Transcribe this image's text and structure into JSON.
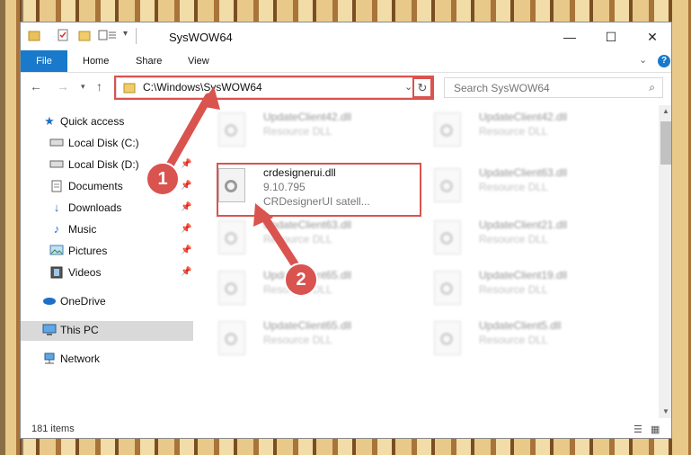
{
  "window": {
    "title": "SysWOW64",
    "controls": {
      "minimize": "—",
      "maximize": "☐",
      "close": "✕"
    }
  },
  "ribbon": {
    "file_label": "File",
    "tabs": [
      "Home",
      "Share",
      "View"
    ],
    "help_label": "?"
  },
  "navigation": {
    "address": "C:\\Windows\\SysWOW64",
    "search_placeholder": "Search SysWOW64"
  },
  "sidebar": {
    "items": [
      {
        "label": "Quick access",
        "icon": "star-icon"
      },
      {
        "label": "Local Disk (C:)",
        "icon": "drive-icon"
      },
      {
        "label": "Local Disk (D:)",
        "icon": "drive-icon"
      },
      {
        "label": "Documents",
        "icon": "documents-icon"
      },
      {
        "label": "Downloads",
        "icon": "download-icon"
      },
      {
        "label": "Music",
        "icon": "music-icon"
      },
      {
        "label": "Pictures",
        "icon": "pictures-icon"
      },
      {
        "label": "Videos",
        "icon": "videos-icon"
      },
      {
        "label": "OneDrive",
        "icon": "cloud-icon"
      },
      {
        "label": "This PC",
        "icon": "computer-icon"
      },
      {
        "label": "Network",
        "icon": "network-icon"
      }
    ]
  },
  "files": {
    "selected": {
      "name": "crdesignerui.dll",
      "version": "9.10.795",
      "description": "CRDesignerUI satell..."
    },
    "left_column": [
      {
        "name": "UpdateClient42.dll",
        "description": "Resource DLL"
      },
      {
        "name": "UpdateClient63.dll",
        "description": "Resource DLL"
      },
      {
        "name": "UpdateClient65.dll",
        "description": "Resource DLL"
      },
      {
        "name": "UpdateClient65.dll",
        "description": "Resource DLL"
      }
    ],
    "right_column": [
      {
        "name": "UpdateClient42.dll",
        "description": "Resource DLL"
      },
      {
        "name": "UpdateClient63.dll",
        "description": "Resource DLL"
      },
      {
        "name": "UpdateClient21.dll",
        "description": "Resource DLL"
      },
      {
        "name": "UpdateClient19.dll",
        "description": "Resource DLL"
      },
      {
        "name": "UpdateClient5.dll",
        "description": "Resource DLL"
      }
    ]
  },
  "status": {
    "item_count": "181 items"
  },
  "annotations": {
    "step1": "1",
    "step2": "2",
    "color": "#d9534f"
  }
}
